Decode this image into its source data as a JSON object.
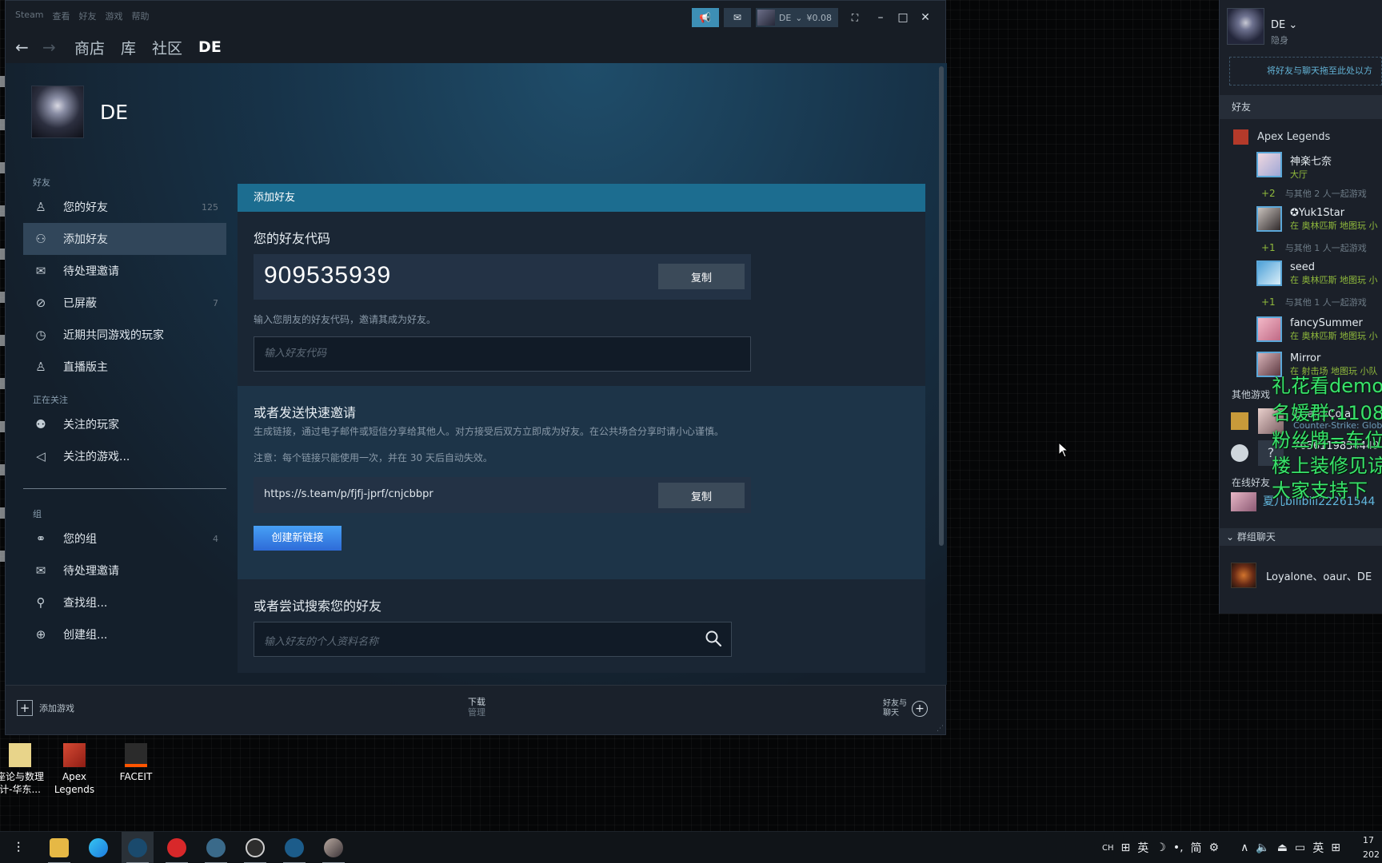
{
  "window": {
    "menu": [
      "Steam",
      "查看",
      "好友",
      "游戏",
      "帮助"
    ],
    "user_name": "DE",
    "wallet": "¥0.08",
    "nav_tabs": [
      "商店",
      "库",
      "社区",
      "DE"
    ]
  },
  "profile": {
    "name": "DE"
  },
  "sidebar": {
    "friends_section": "好友",
    "friends_items": [
      {
        "label": "您的好友",
        "count": "125"
      },
      {
        "label": "添加好友",
        "count": ""
      },
      {
        "label": "待处理邀请",
        "count": ""
      },
      {
        "label": "已屏蔽",
        "count": "7"
      },
      {
        "label": "近期共同游戏的玩家",
        "count": ""
      },
      {
        "label": "直播版主",
        "count": ""
      }
    ],
    "following_section": "正在关注",
    "following_items": [
      {
        "label": "关注的玩家"
      },
      {
        "label": "关注的游戏..."
      }
    ],
    "groups_section": "组",
    "groups_items": [
      {
        "label": "您的组",
        "count": "4"
      },
      {
        "label": "待处理邀请",
        "count": ""
      },
      {
        "label": "查找组...",
        "count": ""
      },
      {
        "label": "创建组...",
        "count": ""
      }
    ]
  },
  "panel": {
    "header": "添加好友",
    "code_title": "您的好友代码",
    "code_value": "909535939",
    "copy_label": "复制",
    "code_hint": "输入您朋友的好友代码，邀请其成为好友。",
    "code_placeholder": "输入好友代码",
    "invite_title": "或者发送快速邀请",
    "invite_desc": "生成链接，通过电子邮件或短信分享给其他人。对方接受后双方立即成为好友。在公共场合分享时请小心谨慎。",
    "invite_note": "注意：每个链接只能使用一次，并在 30 天后自动失效。",
    "invite_link": "https://s.team/p/fjfj-jprf/cnjcbbpr",
    "new_link_label": "创建新链接",
    "search_title": "或者尝试搜索您的好友",
    "search_placeholder": "输入好友的个人资料名称"
  },
  "footer": {
    "add_game": "添加游戏",
    "downloads": "下载",
    "downloads_sub": "管理",
    "friends_chat_line1": "好友与",
    "friends_chat_line2": "聊天"
  },
  "desktop_icons": [
    {
      "label": "座论与数理\n计-华东..."
    },
    {
      "label": "Apex\nLegends"
    },
    {
      "label": "FACEIT"
    }
  ],
  "friends_panel": {
    "user": "DE",
    "status": "隐身",
    "drop_hint": "将好友与聊天拖至此处以方",
    "friends_header": "好友",
    "game_group": "Apex Legends",
    "friends": [
      {
        "name": "神楽七奈",
        "status": "大厅",
        "party_count": "+2",
        "party_text": "与其他 2 人一起游戏"
      },
      {
        "name": "✪Yuk1Star",
        "status": "在 奥林匹斯 地图玩 小",
        "party_count": "+1",
        "party_text": "与其他 1 人一起游戏"
      },
      {
        "name": "seed",
        "status": "在 奥林匹斯 地图玩 小",
        "party_count": "+1",
        "party_text": "与其他 1 人一起游戏"
      },
      {
        "name": "fancySummer",
        "status": "在 奥林匹斯 地图玩 小"
      },
      {
        "name": "Mirror",
        "status": "在 射击场 地图玩 小队"
      }
    ],
    "other_games_header": "其他游戏",
    "other_friends": [
      {
        "name": "CherryCola",
        "status": "Counter-Strike: Glob"
      },
      {
        "name": "7656119834449",
        "status": ""
      }
    ],
    "online_header": "在线好友",
    "online_friends": [
      {
        "name": "夏儿bilibili22261544"
      }
    ],
    "group_chat_header": "群组聊天",
    "group_chat": "Loyalone、oaur、DE"
  },
  "overlay_lines": [
    "礼花看demo",
    "名媛群:1108",
    "粉丝牌=车位",
    "楼上装修见谅",
    "大家支持下"
  ],
  "tray": {
    "items": [
      "CH",
      "英",
      "简",
      "英"
    ],
    "clock_time": "17",
    "clock_date": "202"
  }
}
